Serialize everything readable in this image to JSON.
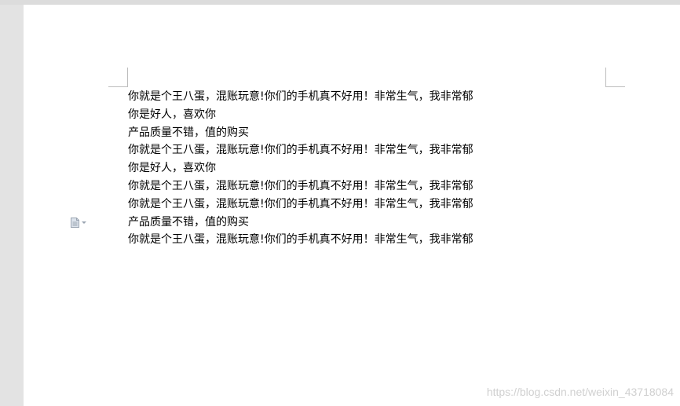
{
  "document": {
    "lines": [
      "你就是个王八蛋，混账玩意!你们的手机真不好用！非常生气，我非常郁",
      "你是好人，喜欢你",
      "产品质量不错，值的购买",
      "你就是个王八蛋，混账玩意!你们的手机真不好用！非常生气，我非常郁",
      "你是好人，喜欢你",
      "你就是个王八蛋，混账玩意!你们的手机真不好用！非常生气，我非常郁",
      "你就是个王八蛋，混账玩意!你们的手机真不好用！非常生气，我非常郁",
      "产品质量不错，值的购买",
      "你就是个王八蛋，混账玩意!你们的手机真不好用！非常生气，我非常郁"
    ]
  },
  "paste_options": {
    "icon": "paste-options-icon"
  },
  "watermark": {
    "text": "https://blog.csdn.net/weixin_43718084"
  },
  "colors": {
    "canvas_background": "#e3e3e3",
    "page_background": "#ffffff",
    "text": "#000000",
    "margin_marks": "#bdbdbd",
    "icon": "#9aa4b1"
  }
}
